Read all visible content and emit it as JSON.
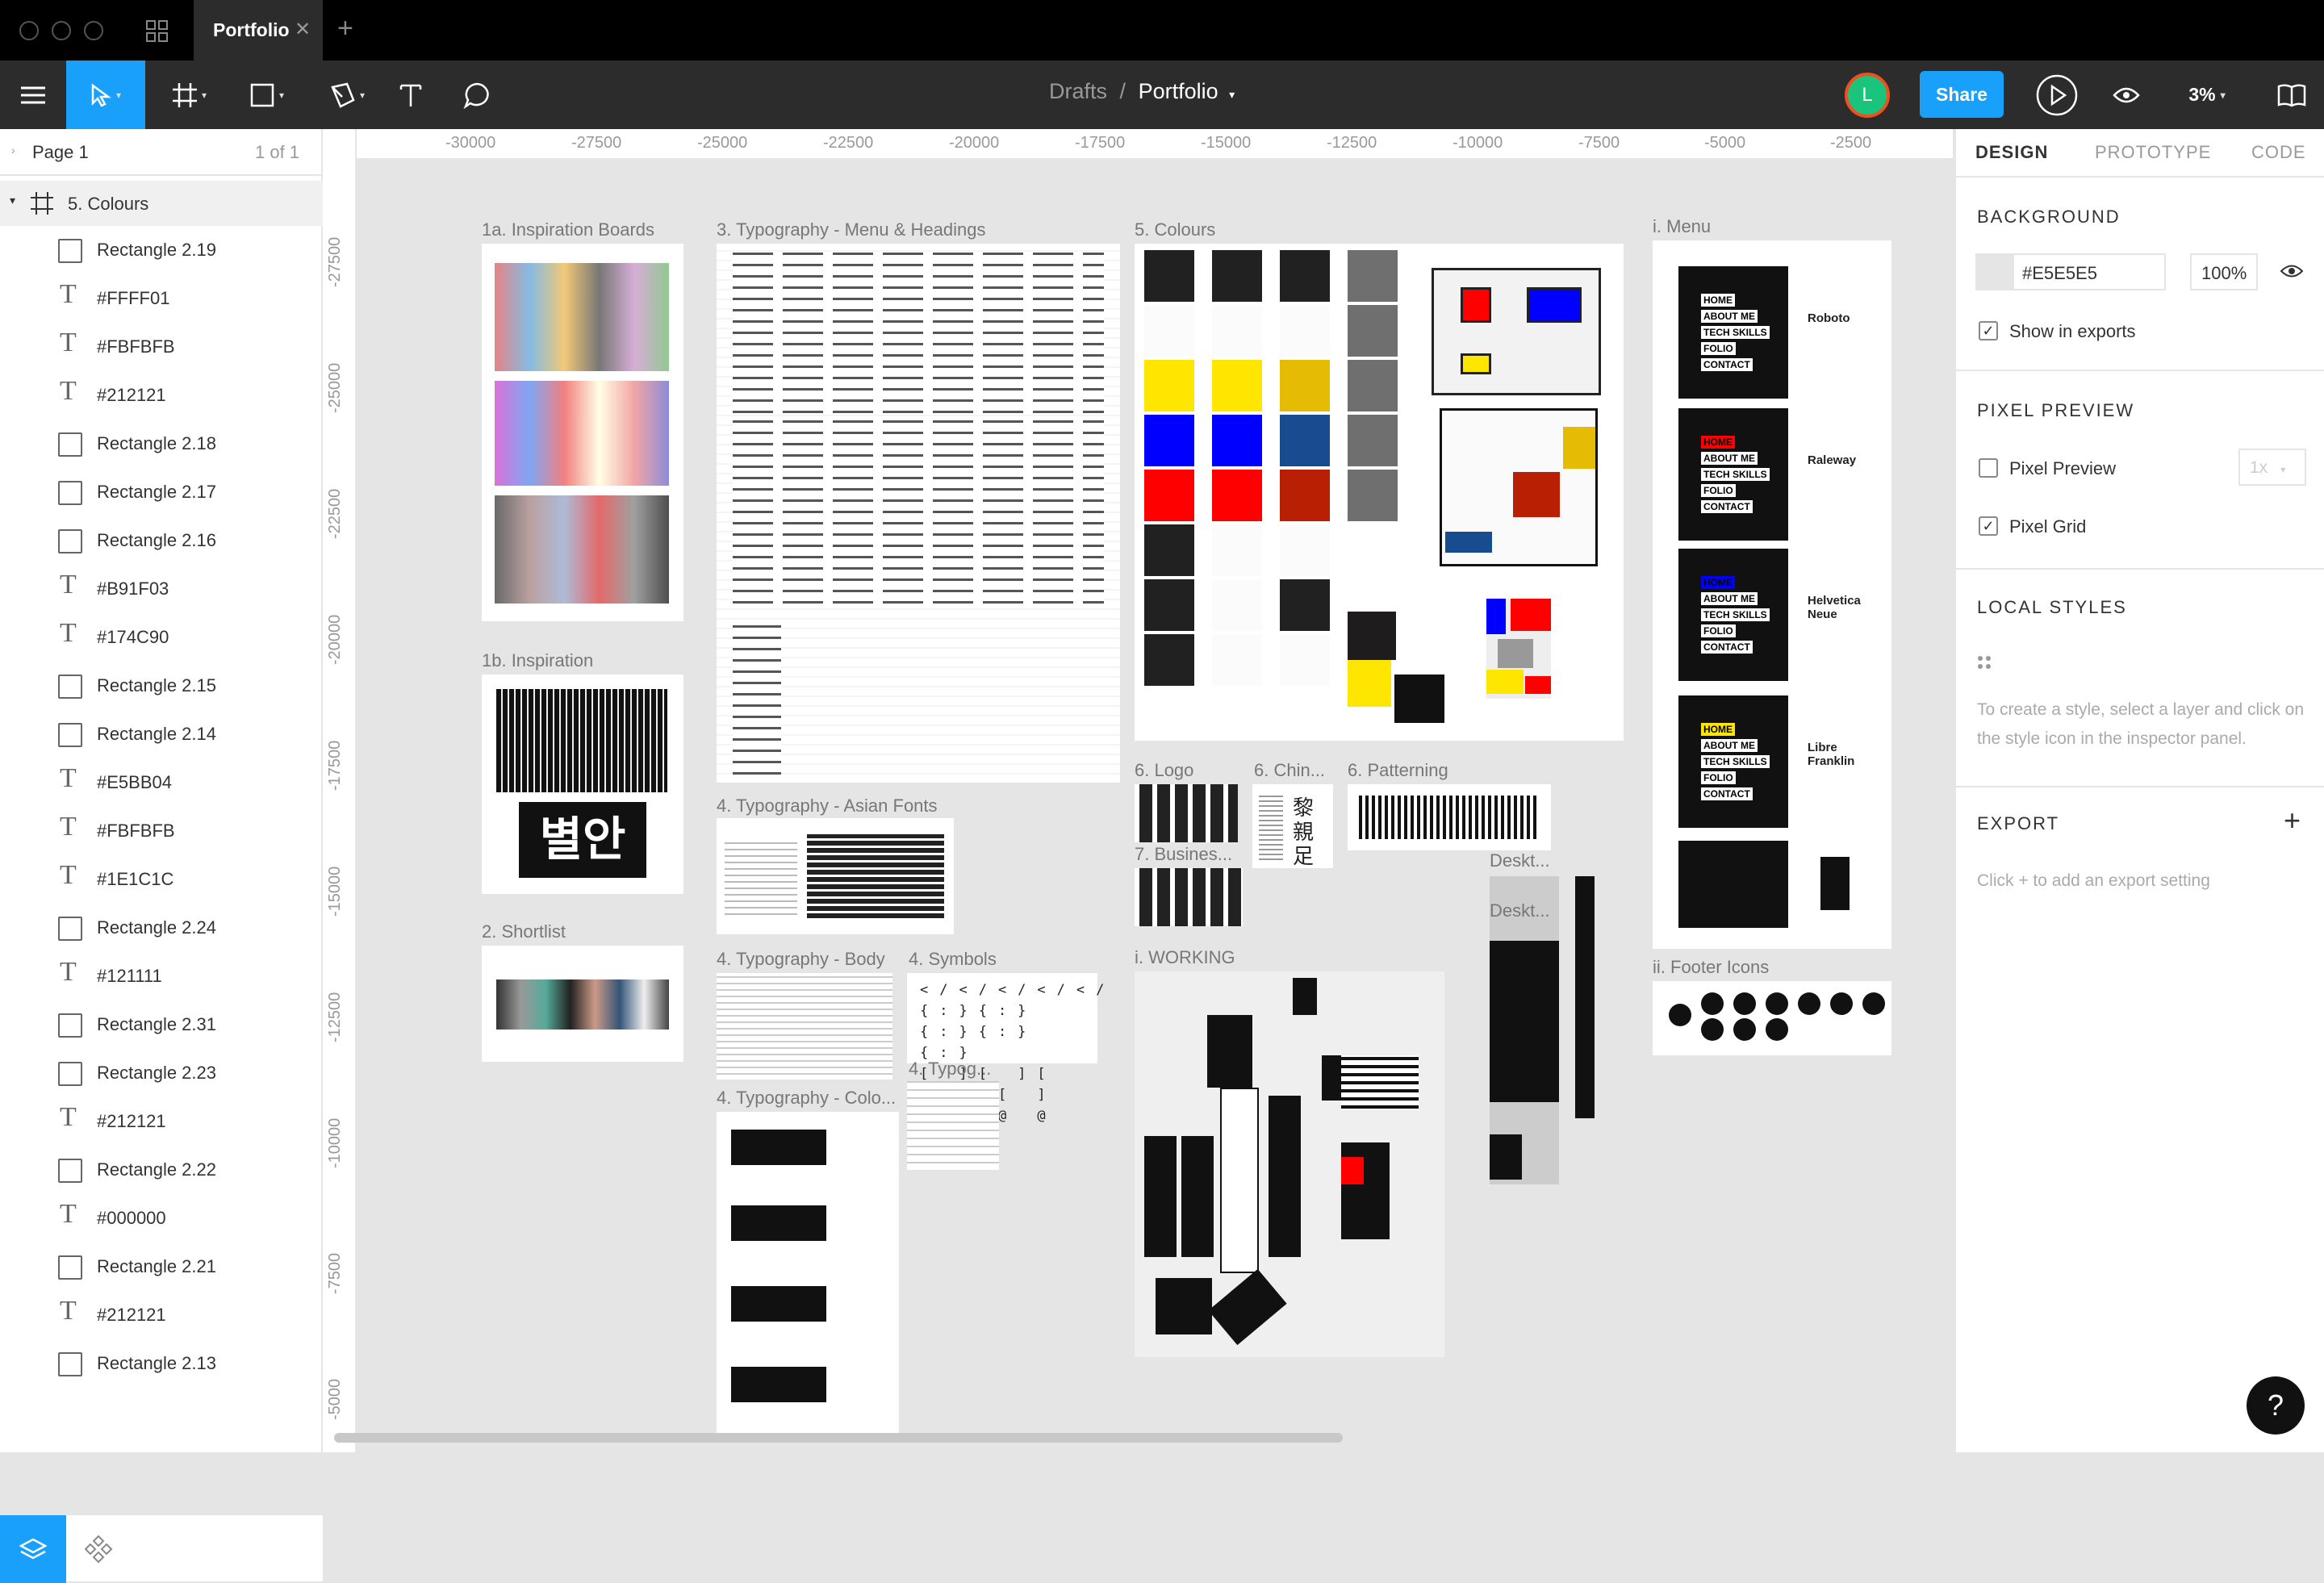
{
  "window": {
    "tab_title": "Portfolio"
  },
  "breadcrumb": {
    "parent": "Drafts",
    "separator": "/",
    "current": "Portfolio"
  },
  "toolbar": {
    "avatar_initial": "L",
    "share_label": "Share",
    "zoom": "3%"
  },
  "layers": {
    "page_name": "Page 1",
    "page_count": "1 of 1",
    "frame_name": "5. Colours",
    "items": [
      {
        "type": "rect",
        "name": "Rectangle 2.19"
      },
      {
        "type": "text",
        "name": "#FFFF01"
      },
      {
        "type": "text",
        "name": "#FBFBFB"
      },
      {
        "type": "text",
        "name": "#212121"
      },
      {
        "type": "rect",
        "name": "Rectangle 2.18"
      },
      {
        "type": "rect",
        "name": "Rectangle 2.17"
      },
      {
        "type": "rect",
        "name": "Rectangle 2.16"
      },
      {
        "type": "text",
        "name": "#B91F03"
      },
      {
        "type": "text",
        "name": "#174C90"
      },
      {
        "type": "rect",
        "name": "Rectangle 2.15"
      },
      {
        "type": "rect",
        "name": "Rectangle 2.14"
      },
      {
        "type": "text",
        "name": "#E5BB04"
      },
      {
        "type": "text",
        "name": "#FBFBFB"
      },
      {
        "type": "text",
        "name": "#1E1C1C"
      },
      {
        "type": "rect",
        "name": "Rectangle 2.24"
      },
      {
        "type": "text",
        "name": "#121111"
      },
      {
        "type": "rect",
        "name": "Rectangle 2.31"
      },
      {
        "type": "rect",
        "name": "Rectangle 2.23"
      },
      {
        "type": "text",
        "name": "#212121"
      },
      {
        "type": "rect",
        "name": "Rectangle 2.22"
      },
      {
        "type": "text",
        "name": "#000000"
      },
      {
        "type": "rect",
        "name": "Rectangle 2.21"
      },
      {
        "type": "text",
        "name": "#212121"
      },
      {
        "type": "rect",
        "name": "Rectangle 2.13"
      }
    ]
  },
  "rulers": {
    "h": [
      "-30000",
      "-27500",
      "-25000",
      "-22500",
      "-20000",
      "-17500",
      "-15000",
      "-12500",
      "-10000",
      "-7500",
      "-5000",
      "-2500"
    ],
    "v": [
      "-27500",
      "-25000",
      "-22500",
      "-20000",
      "-17500",
      "-15000",
      "-12500",
      "-10000",
      "-7500",
      "-5000"
    ]
  },
  "inspector": {
    "tabs": [
      "DESIGN",
      "PROTOTYPE",
      "CODE"
    ],
    "background_title": "BACKGROUND",
    "bg_hex": "#E5E5E5",
    "bg_opacity": "100%",
    "show_in_exports": "Show in exports",
    "pixel_preview_title": "PIXEL PREVIEW",
    "pixel_preview_label": "Pixel Preview",
    "pixel_preview_scale": "1x",
    "pixel_grid_label": "Pixel Grid",
    "local_styles_title": "LOCAL STYLES",
    "local_styles_hint": "To create a style, select a layer and click on the style icon in the inspector panel.",
    "export_title": "EXPORT",
    "export_hint": "Click + to add an export setting"
  },
  "canvas": {
    "frames": {
      "f1a": "1a. Inspiration Boards",
      "f1b": "1b. Inspiration",
      "f2": "2. Shortlist",
      "f3": "3. Typography - Menu & Headings",
      "f4asian": "4. Typography - Asian Fonts",
      "f4body": "4. Typography - Body",
      "f4sym": "4. Symbols",
      "f4typog": "4. Typog...",
      "f4colo": "4. Typography - Colo...",
      "f5": "5. Colours",
      "f6logo": "6. Logo",
      "f6chin": "6. Chin...",
      "f6pat": "6. Patterning",
      "f7": "7. Busines...",
      "fworking": "i. WORKING",
      "fdesk1": "Deskt...",
      "fdesk2": "Deskt...",
      "fmenu": "i. Menu",
      "ffooter": "ii. Footer Icons"
    },
    "korean": "별안",
    "swatch_colors": {
      "black": "#212121",
      "yellow": "#FFE600",
      "blue": "#0000FF",
      "red": "#FF0000",
      "darkyellow": "#E5BB04",
      "darkblue": "#174C90",
      "darkred": "#B91F03",
      "grey": "#6F6F6F",
      "offwhite": "#FBFBFB"
    },
    "menu_fonts": [
      "Roboto",
      "Raleway",
      "Helvetica Neue",
      "Libre Franklin"
    ],
    "menu_items": [
      "HOME",
      "ABOUT ME",
      "TECH SKILLS",
      "FOLIO",
      "CONTACT"
    ]
  }
}
